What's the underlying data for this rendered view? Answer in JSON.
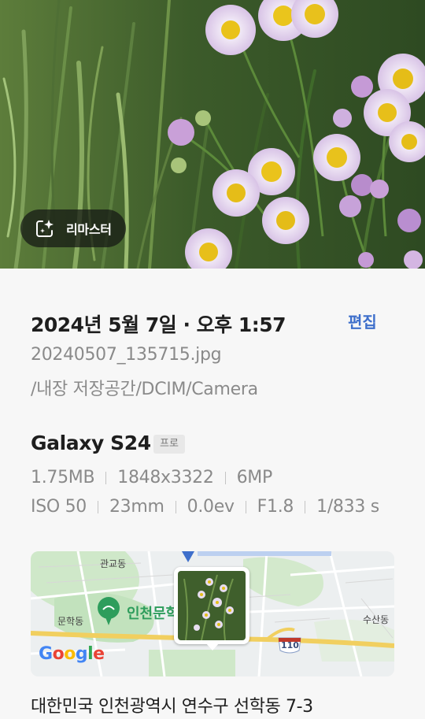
{
  "photo": {
    "remaster_label": "리마스터"
  },
  "details": {
    "date_time": "2024년 5월 7일 · 오후 1:57",
    "edit_label": "편집",
    "filename": "20240507_135715.jpg",
    "path": "/내장 저장공간/DCIM/Camera"
  },
  "camera": {
    "model": "Galaxy S24",
    "mode_badge": "프로",
    "file_size": "1.75MB",
    "resolution": "1848x3322",
    "megapixels": "6MP",
    "iso": "ISO 50",
    "focal_length": "23mm",
    "exposure": "0.0ev",
    "aperture": "F1.8",
    "shutter": "1/833 s"
  },
  "map": {
    "labels": {
      "gwangyo": "관교동",
      "munhak": "문학동",
      "incheon_munhak": "인천문학",
      "susan": "수산동",
      "route": "110"
    },
    "google_letters": [
      "G",
      "o",
      "o",
      "g",
      "l",
      "e"
    ],
    "google_colors": [
      "#4285F4",
      "#EA4335",
      "#FBBC05",
      "#4285F4",
      "#34A853",
      "#EA4335"
    ]
  },
  "location": {
    "address": "대한민국 인천광역시 연수구 선학동 7-3"
  }
}
